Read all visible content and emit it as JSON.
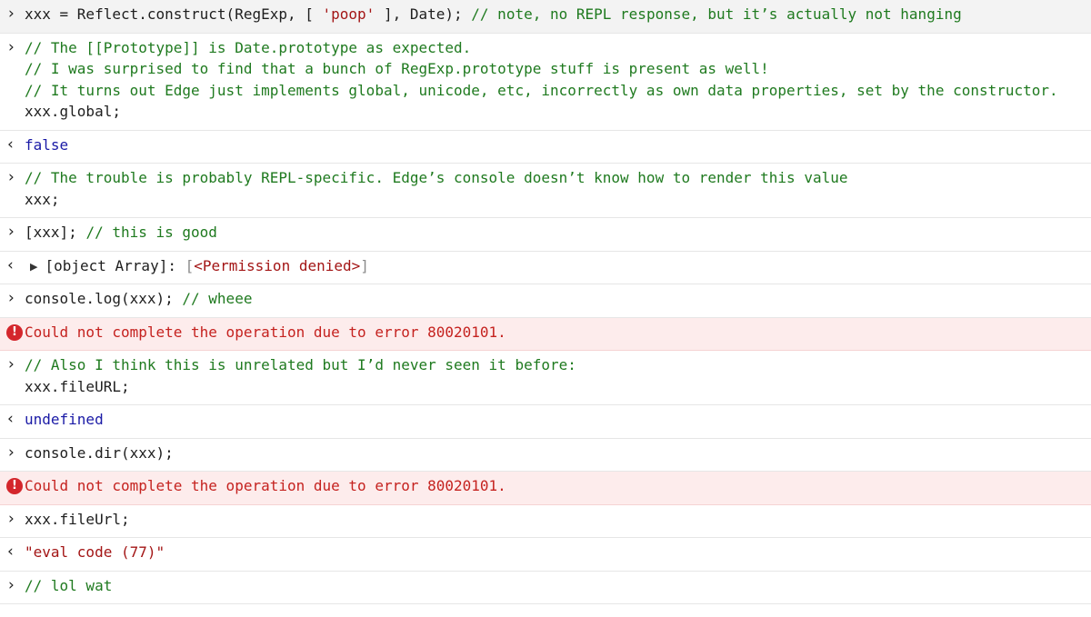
{
  "entries": [
    {
      "kind": "input",
      "tinted": true,
      "lines": [
        [
          [
            "code",
            "xxx = Reflect.construct(RegExp, [ "
          ],
          [
            "str",
            "'poop'"
          ],
          [
            "code",
            " ], Date); "
          ],
          [
            "cmt",
            "// note, no REPL response, but it’s actually not hanging"
          ]
        ]
      ]
    },
    {
      "kind": "input",
      "lines": [
        [
          [
            "cmt",
            "// The [[Prototype]] is Date.prototype as expected."
          ]
        ],
        [
          [
            "cmt",
            "// I was surprised to find that a bunch of RegExp.prototype stuff is present as well!"
          ]
        ],
        [
          [
            "cmt",
            "// It turns out Edge just implements global, unicode, etc, incorrectly as own data properties, set by the constructor."
          ]
        ],
        [
          [
            "code",
            "xxx.global;"
          ]
        ]
      ]
    },
    {
      "kind": "output",
      "lines": [
        [
          [
            "kw",
            "false"
          ]
        ]
      ]
    },
    {
      "kind": "input",
      "lines": [
        [
          [
            "cmt",
            "// The trouble is probably REPL-specific. Edge’s console doesn’t know how to render this value"
          ]
        ],
        [
          [
            "code",
            "xxx;"
          ]
        ]
      ]
    },
    {
      "kind": "input",
      "lines": [
        [
          [
            "code",
            "[xxx]; "
          ],
          [
            "cmt",
            "// this is good"
          ]
        ]
      ]
    },
    {
      "kind": "output-expandable",
      "lines": [
        [
          [
            "code",
            "[object Array]: "
          ],
          [
            "dim",
            "["
          ],
          [
            "str",
            "<Permission denied>"
          ],
          [
            "dim",
            "]"
          ]
        ]
      ]
    },
    {
      "kind": "input",
      "lines": [
        [
          [
            "code",
            "console.log(xxx); "
          ],
          [
            "cmt",
            "// wheee"
          ]
        ]
      ]
    },
    {
      "kind": "error",
      "lines": [
        [
          [
            "errtext",
            "Could not complete the operation due to error 80020101."
          ]
        ]
      ]
    },
    {
      "kind": "input",
      "lines": [
        [
          [
            "cmt",
            "// Also I think this is unrelated but I’d never seen it before:"
          ]
        ],
        [
          [
            "code",
            "xxx.fileURL;"
          ]
        ]
      ]
    },
    {
      "kind": "output",
      "lines": [
        [
          [
            "kw",
            "undefined"
          ]
        ]
      ]
    },
    {
      "kind": "input",
      "lines": [
        [
          [
            "code",
            "console.dir(xxx);"
          ]
        ]
      ]
    },
    {
      "kind": "error",
      "lines": [
        [
          [
            "errtext",
            "Could not complete the operation due to error 80020101."
          ]
        ]
      ]
    },
    {
      "kind": "input",
      "lines": [
        [
          [
            "code",
            "xxx.fileUrl;"
          ]
        ]
      ]
    },
    {
      "kind": "output",
      "lines": [
        [
          [
            "str",
            "\"eval code (77)\""
          ]
        ]
      ]
    },
    {
      "kind": "input",
      "lines": [
        [
          [
            "cmt",
            "// lol wat"
          ]
        ]
      ]
    }
  ],
  "icons": {
    "input": "chevron-right-icon",
    "output": "chevron-left-icon",
    "error": "error-icon",
    "expand": "expand-triangle-icon"
  },
  "colors": {
    "comment": "#1f7a1f",
    "string": "#a31515",
    "keyword": "#1a1aa6",
    "error": "#c5221f",
    "error_bg": "#fdecec"
  }
}
